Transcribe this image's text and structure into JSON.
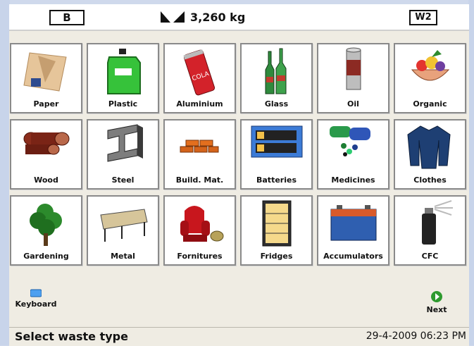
{
  "header": {
    "left_truck": "B",
    "weight": "3,260 kg",
    "right_truck": "W2"
  },
  "categories": [
    {
      "label": "Paper",
      "icon": "paper-icon"
    },
    {
      "label": "Plastic",
      "icon": "plastic-icon"
    },
    {
      "label": "Aluminium",
      "icon": "aluminium-icon"
    },
    {
      "label": "Glass",
      "icon": "glass-icon"
    },
    {
      "label": "Oil",
      "icon": "oil-icon"
    },
    {
      "label": "Organic",
      "icon": "organic-icon"
    },
    {
      "label": "Wood",
      "icon": "wood-icon"
    },
    {
      "label": "Steel",
      "icon": "steel-icon"
    },
    {
      "label": "Build. Mat.",
      "icon": "bricks-icon"
    },
    {
      "label": "Batteries",
      "icon": "batteries-icon"
    },
    {
      "label": "Medicines",
      "icon": "medicines-icon"
    },
    {
      "label": "Clothes",
      "icon": "clothes-icon"
    },
    {
      "label": "Gardening",
      "icon": "tree-icon"
    },
    {
      "label": "Metal",
      "icon": "metal-icon"
    },
    {
      "label": "Fornitures",
      "icon": "armchair-icon"
    },
    {
      "label": "Fridges",
      "icon": "fridge-icon"
    },
    {
      "label": "Accumulators",
      "icon": "car-battery-icon"
    },
    {
      "label": "CFC",
      "icon": "spray-can-icon"
    }
  ],
  "footer": {
    "keyboard_label": "Keyboard",
    "next_label": "Next"
  },
  "status": {
    "message": "Select waste type",
    "datetime": "29-4-2009  06:23 PM"
  }
}
